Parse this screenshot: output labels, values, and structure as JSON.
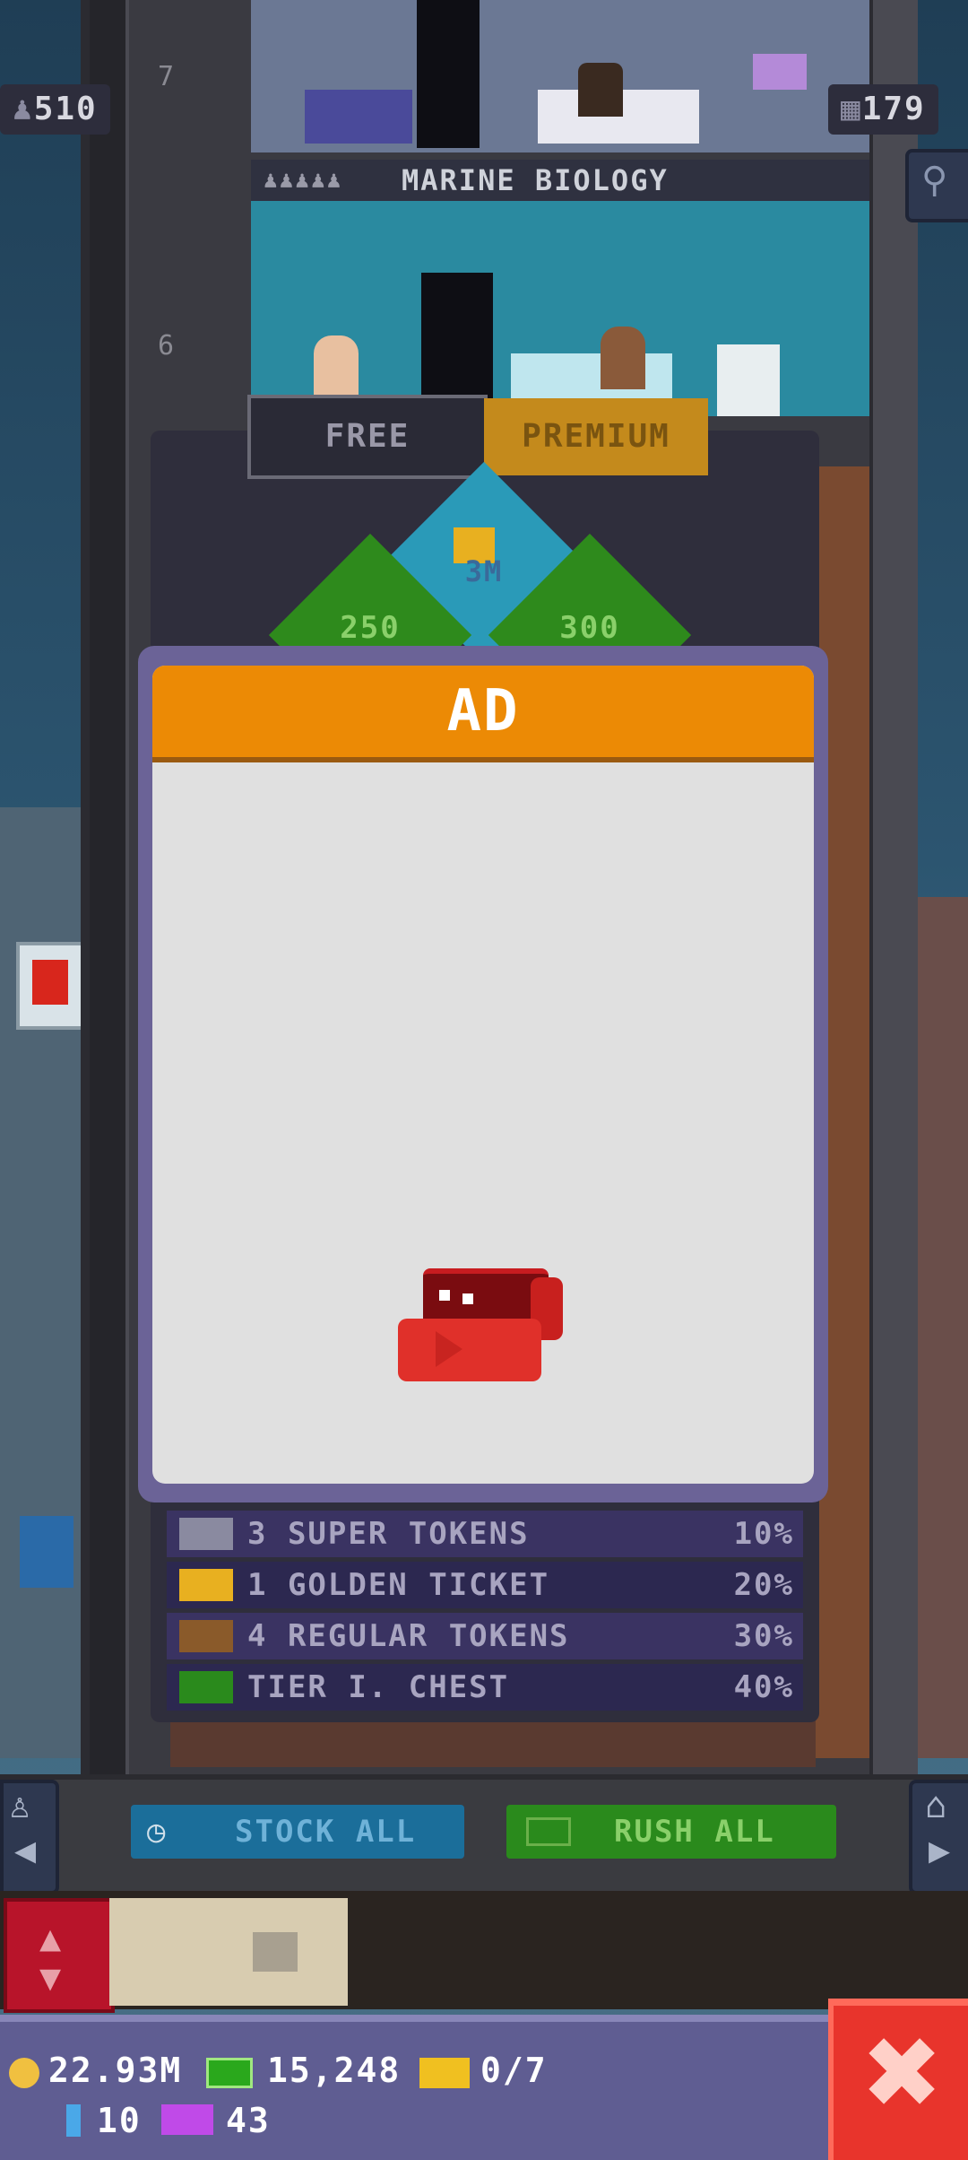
{
  "hud": {
    "population": "510",
    "floors": "179"
  },
  "tower": {
    "floor_numbers": [
      "7",
      "6"
    ],
    "floor6_name": "MARINE BIOLOGY"
  },
  "tabs": {
    "free_label": "FREE",
    "premium_label": "PREMIUM"
  },
  "tiles": {
    "top_value": "3M",
    "left_value": "250",
    "right_value": "300"
  },
  "ad": {
    "title": "AD"
  },
  "rewards": [
    {
      "label": "3 SUPER TOKENS",
      "chance": "10%",
      "icon": "super-token-icon"
    },
    {
      "label": "1 GOLDEN TICKET",
      "chance": "20%",
      "icon": "golden-ticket-icon"
    },
    {
      "label": "4 REGULAR TOKENS",
      "chance": "30%",
      "icon": "regular-token-icon"
    },
    {
      "label": "TIER I. CHEST",
      "chance": "40%",
      "icon": "chest-icon"
    }
  ],
  "actions": {
    "stock_all": "STOCK ALL",
    "rush_all": "RUSH ALL"
  },
  "status": {
    "coins": "22.93M",
    "bux": "15,248",
    "tickets": "0/7",
    "keys": "10",
    "vip": "43"
  },
  "colors": {
    "ad_header": "#ec8a05",
    "close_button": "#e8342c",
    "status_bar": "#5f5d92"
  }
}
